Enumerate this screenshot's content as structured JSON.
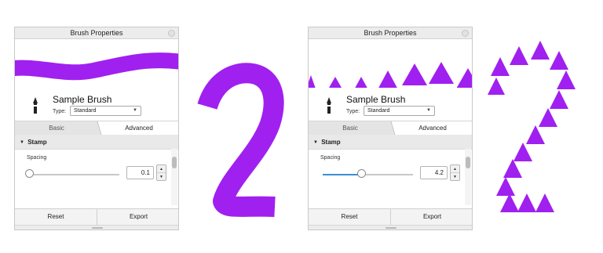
{
  "colors": {
    "brush_purple": "#a020f0",
    "accent_blue": "#3a8fd6",
    "panel_border": "#c9c9c9"
  },
  "panels": [
    {
      "title": "Brush Properties",
      "brush_name": "Sample Brush",
      "type_label": "Type:",
      "type_value": "Standard",
      "tabs": [
        "Basic",
        "Advanced"
      ],
      "active_tab": "Advanced",
      "section_title": "Stamp",
      "spacing_label": "Spacing",
      "spacing_value": "0.1",
      "spacing_level": 0.0,
      "reset_label": "Reset",
      "export_label": "Export",
      "preview_style": "continuous-stroke"
    },
    {
      "title": "Brush Properties",
      "brush_name": "Sample Brush",
      "type_label": "Type:",
      "type_value": "Standard",
      "tabs": [
        "Basic",
        "Advanced"
      ],
      "active_tab": "Advanced",
      "section_title": "Stamp",
      "spacing_label": "Spacing",
      "spacing_value": "4.2",
      "spacing_level": 0.43,
      "reset_label": "Reset",
      "export_label": "Export",
      "preview_style": "stamped-triangles"
    }
  ],
  "icons": {
    "brush": "brush-nib-icon",
    "close": "close-dot-icon",
    "collapse": "triangle-down-icon",
    "step_up": "triangle-up-icon",
    "step_down": "triangle-down-icon",
    "dropdown": "chevron-down-icon"
  },
  "artwork": [
    {
      "name": "continuous-stroke-sample",
      "style": "continuous"
    },
    {
      "name": "stamped-stroke-sample",
      "style": "stamped"
    }
  ]
}
